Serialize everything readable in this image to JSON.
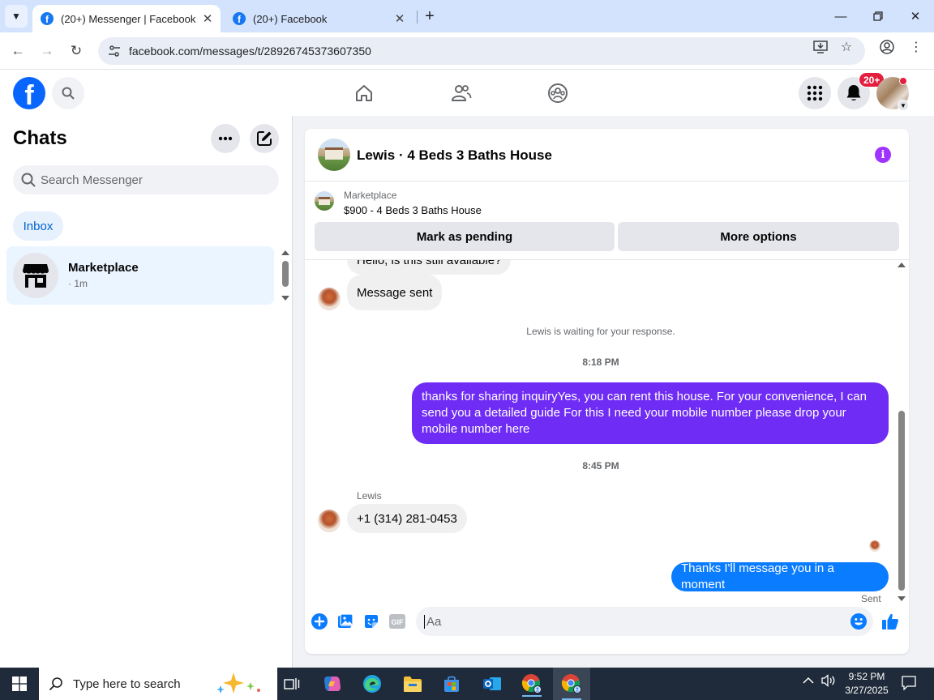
{
  "browser": {
    "tabs": [
      {
        "title": "(20+) Messenger | Facebook",
        "active": true
      },
      {
        "title": "(20+) Facebook",
        "active": false
      }
    ],
    "url": "facebook.com/messages/t/28926745373607350"
  },
  "fb_header": {
    "notification_badge": "20+"
  },
  "sidebar": {
    "title": "Chats",
    "search_placeholder": "Search Messenger",
    "filter_inbox": "Inbox",
    "chats": [
      {
        "name": "Marketplace",
        "subtitle": "· 1m"
      }
    ]
  },
  "conversation": {
    "title": "Lewis · 4 Beds 3 Baths House",
    "marketplace": {
      "label": "Marketplace",
      "item": "$900 - 4 Beds 3 Baths House",
      "mark_pending": "Mark as pending",
      "more_options": "More options"
    },
    "messages": {
      "cut_off": "Hello, is this still available?",
      "message_sent": "Message sent",
      "waiting": "Lewis is waiting for your response.",
      "time1": "8:18 PM",
      "outgoing1": "thanks for sharing inquiryYes, you can rent this house. For your convenience, I can send you a detailed guide For this I need your mobile number please drop your mobile number here",
      "time2": "8:45 PM",
      "sender": "Lewis",
      "incoming_phone": "+1 (314) 281-0453",
      "outgoing2": "Thanks I'll message you in a moment",
      "status": "Sent"
    },
    "composer_placeholder": "Aa"
  },
  "taskbar": {
    "search_placeholder": "Type here to search",
    "time": "9:52 PM",
    "date": "3/27/2025"
  },
  "colors": {
    "fb_blue": "#0866ff",
    "bubble_purple": "#6f2cf5",
    "bubble_blue": "#0a7cff",
    "info_purple": "#a033ff"
  }
}
